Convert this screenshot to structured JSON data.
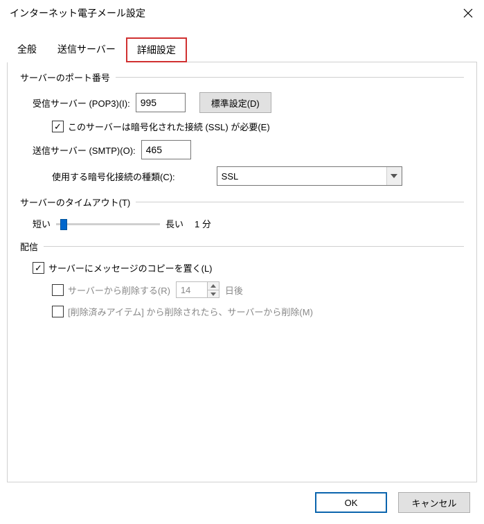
{
  "window": {
    "title": "インターネット電子メール設定"
  },
  "tabs": {
    "general": "全般",
    "outgoing": "送信サーバー",
    "advanced": "詳細設定"
  },
  "groups": {
    "ports": {
      "title": "サーバーのポート番号",
      "pop3_label": "受信サーバー (POP3)(I):",
      "pop3_value": "995",
      "defaults_btn": "標準設定(D)",
      "ssl_required_label": "このサーバーは暗号化された接続 (SSL) が必要(E)",
      "smtp_label": "送信サーバー (SMTP)(O):",
      "smtp_value": "465",
      "encryption_label": "使用する暗号化接続の種類(C):",
      "encryption_value": "SSL"
    },
    "timeout": {
      "title": "サーバーのタイムアウト(T)",
      "short": "短い",
      "long": "長い",
      "value_text": "1 分"
    },
    "delivery": {
      "title": "配信",
      "leave_copy": "サーバーにメッセージのコピーを置く(L)",
      "remove_after_label": "サーバーから削除する(R)",
      "remove_after_days": "14",
      "days_suffix": "日後",
      "remove_on_delete": "[削除済みアイテム] から削除されたら、サーバーから削除(M)"
    }
  },
  "footer": {
    "ok": "OK",
    "cancel": "キャンセル"
  }
}
